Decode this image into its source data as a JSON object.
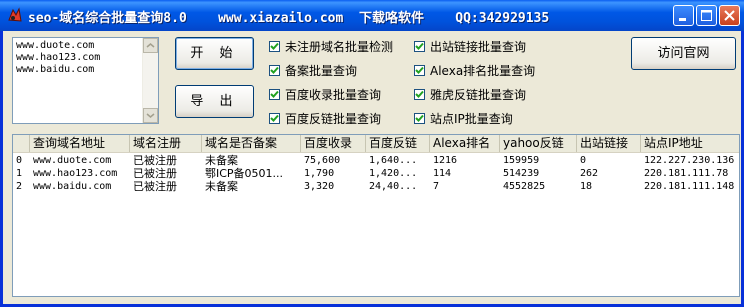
{
  "window": {
    "title": "seo-域名综合批量查询8.0    www.xiazailo.com  下载咯软件    QQ:342929135"
  },
  "domains_input": [
    "www.duote.com",
    "www.hao123.com",
    "www.baidu.com"
  ],
  "buttons": {
    "open": "开 始",
    "export": "导 出",
    "visit_site": "访问官网"
  },
  "options": [
    {
      "label": "未注册域名批量检测",
      "checked": true
    },
    {
      "label": "备案批量查询",
      "checked": true
    },
    {
      "label": "百度收录批量查询",
      "checked": true
    },
    {
      "label": "百度反链批量查询",
      "checked": true
    },
    {
      "label": "出站链接批量查询",
      "checked": true
    },
    {
      "label": "Alexa排名批量查询",
      "checked": true
    },
    {
      "label": "雅虎反链批量查询",
      "checked": true
    },
    {
      "label": "站点IP批量查询",
      "checked": true
    }
  ],
  "table": {
    "columns": [
      "查询域名地址",
      "域名注册",
      "域名是否备案",
      "百度收录",
      "百度反链",
      "Alexa排名",
      "yahoo反链",
      "出站链接",
      "站点IP地址"
    ],
    "rows": [
      {
        "index": "0",
        "cells": [
          "www.duote.com",
          "已被注册",
          "未备案",
          "75,600",
          "1,640...",
          "1216",
          "159959",
          "0",
          "122.227.230.136"
        ]
      },
      {
        "index": "1",
        "cells": [
          "www.hao123.com",
          "已被注册",
          "鄂ICP备0501...",
          "1,790",
          "1,420...",
          "114",
          "514239",
          "262",
          "220.181.111.78"
        ]
      },
      {
        "index": "2",
        "cells": [
          "www.baidu.com",
          "已被注册",
          "未备案",
          "3,320",
          "24,40...",
          "7",
          "4552825",
          "18",
          "220.181.111.148"
        ]
      }
    ]
  }
}
